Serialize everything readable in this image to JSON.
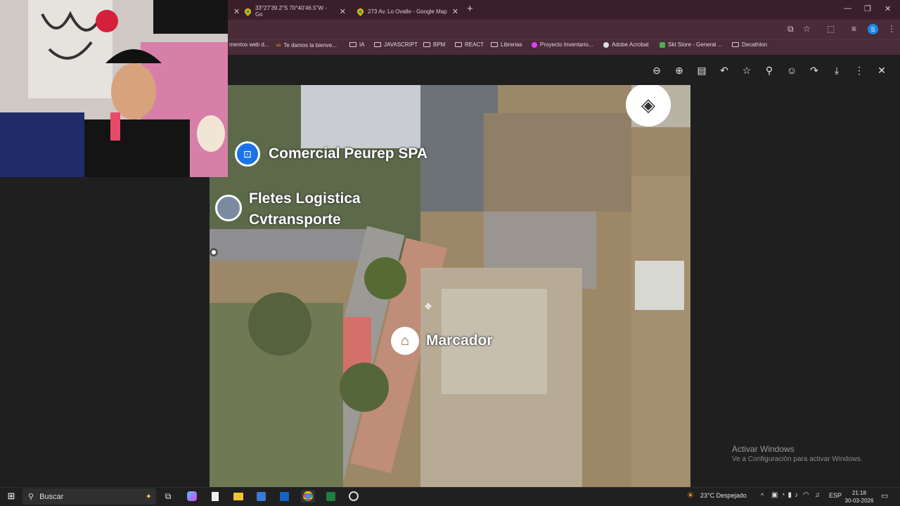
{
  "tabs": [
    {
      "title": "33°27'39.2\"S 70°40'46.5\"W - Go"
    },
    {
      "title": "273 Av. Lo Ovalle - Google Map"
    }
  ],
  "new_tab": "+",
  "bookmarks": [
    {
      "label": "mentos web d...",
      "icon": "page-icon"
    },
    {
      "label": "Te damos la bienve...",
      "icon": "link-icon"
    },
    {
      "label": "IA",
      "icon": "folder-icon"
    },
    {
      "label": "JAVASCRIPT",
      "icon": "folder-icon"
    },
    {
      "label": "BPM",
      "icon": "folder-icon"
    },
    {
      "label": "REACT",
      "icon": "folder-icon"
    },
    {
      "label": "Librerias",
      "icon": "folder-icon"
    },
    {
      "label": "Proyecto Inventario...",
      "icon": "bookmark-icon"
    },
    {
      "label": "Adobe Acrobat",
      "icon": "acrobat-icon"
    },
    {
      "label": "Skt Store - General ...",
      "icon": "store-icon"
    },
    {
      "label": "Decathlon",
      "icon": "folder-icon"
    }
  ],
  "profile_initial": "S",
  "map": {
    "labels": {
      "place1": "Comercial Peurep SPA",
      "place2_line1": "Fletes Logistica",
      "place2_line2": "Cvtransporte",
      "marker": "Marcador"
    }
  },
  "watermark": {
    "line1": "Activar Windows",
    "line2": "Ve a Configuración para activar Windows."
  },
  "taskbar": {
    "search_placeholder": "Buscar",
    "weather": "23°C  Despejado",
    "language": "ESP",
    "time": "21:18",
    "date": "30-03-2026"
  }
}
